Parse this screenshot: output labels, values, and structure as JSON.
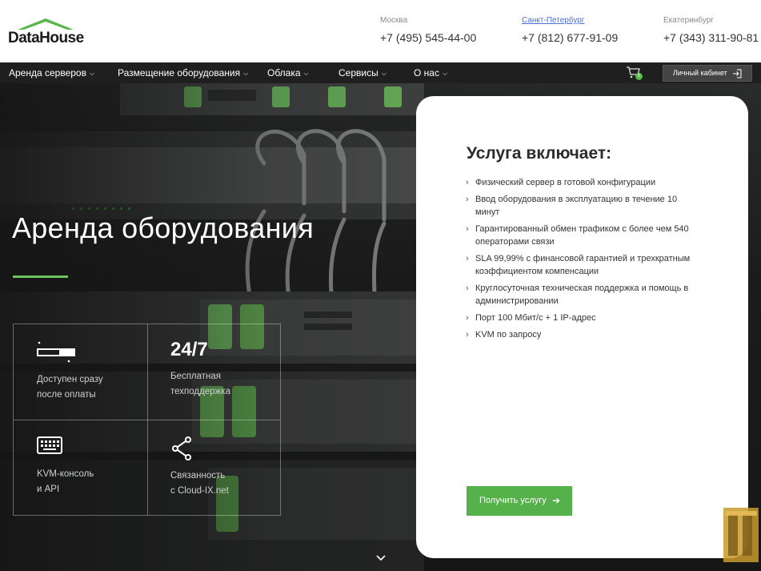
{
  "header": {
    "logo_text": "DataHouse",
    "phones": [
      {
        "city": "Москва",
        "number": "+7 (495) 545-44-00"
      },
      {
        "city": "Санкт-Петербург",
        "number": "+7 (812) 677-91-09"
      },
      {
        "city": "Екатеринбург",
        "number": "+7 (343) 311-90-81"
      }
    ]
  },
  "nav": {
    "items": [
      {
        "label": "Аренда серверов"
      },
      {
        "label": "Размещение оборудования"
      },
      {
        "label": "Облака"
      },
      {
        "label": "Сервисы"
      },
      {
        "label": "О нас"
      }
    ],
    "cart_count": "0",
    "cabinet_label": "Личный кабинет"
  },
  "hero": {
    "title": "Аренда оборудования",
    "features": [
      {
        "big": "",
        "line1": "Доступен сразу",
        "line2": "после оплаты",
        "icon": "server-icon"
      },
      {
        "big": "24/7",
        "line1": "Бесплатная",
        "line2": "техподдержка",
        "icon": ""
      },
      {
        "big": "",
        "line1": "KVM-консоль",
        "line2": "и API",
        "icon": "keyboard-icon"
      },
      {
        "big": "",
        "line1": "Связанность",
        "line2": "с Cloud-IX.net",
        "icon": "network-icon"
      }
    ]
  },
  "card": {
    "title": "Услуга включает:",
    "items": [
      "Физический сервер в готовой конфигурации",
      "Ввод оборудования в эксплуатацию в течение 10 минут",
      "Гарантированный обмен трафиком с более чем 540 операторами связи",
      "SLA 99,99% с финансовой гарантией и трехкратным коэффициентом компенсации",
      "Круглосуточная техническая поддержка и помощь в администрировании",
      "Порт 100 Мбит/с + 1 IP-адрес",
      "KVM по запросу"
    ],
    "cta_label": "Получить услугу"
  },
  "colors": {
    "accent": "#55b14a",
    "nav_bg": "#1f1f1f",
    "hero_bg": "#1b1c1b"
  }
}
